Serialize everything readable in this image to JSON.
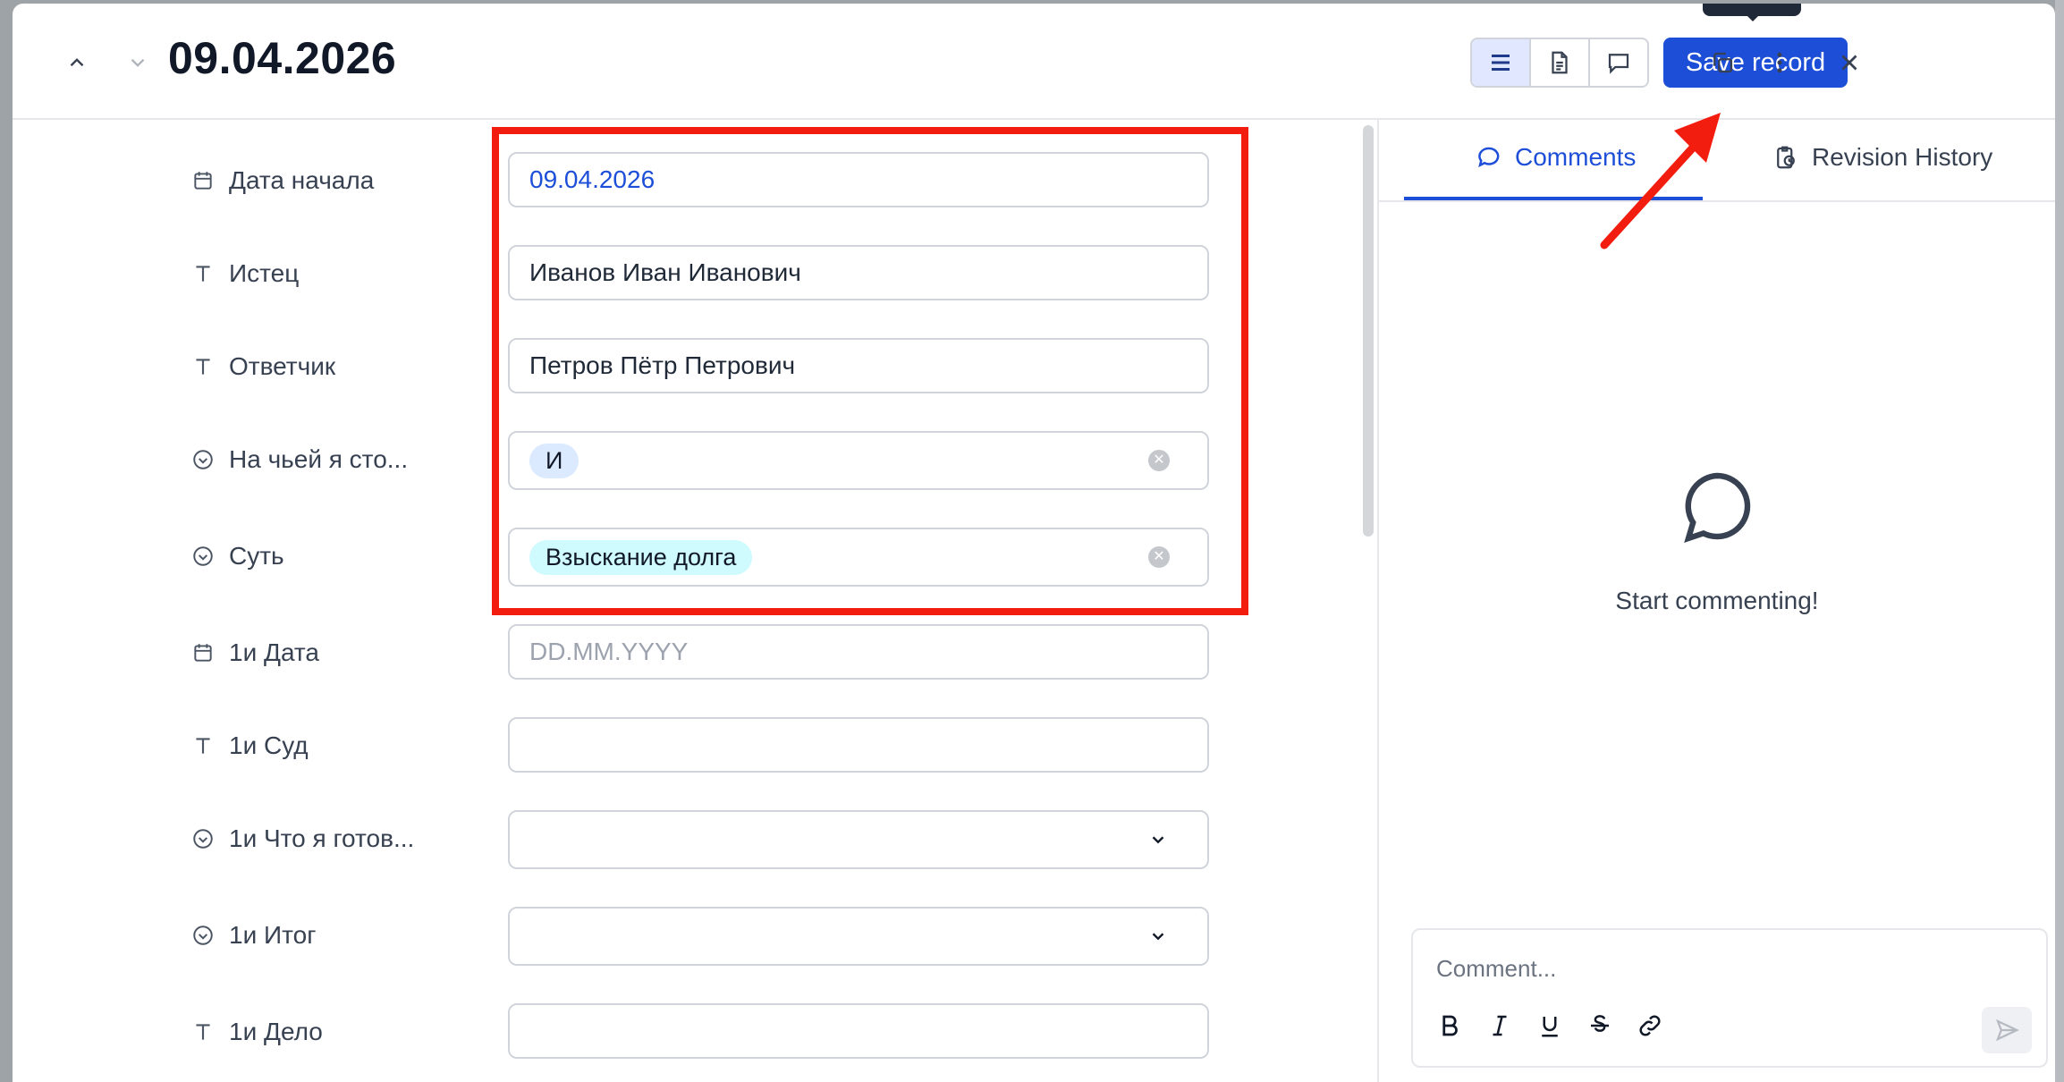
{
  "header": {
    "title": "09.04.2026",
    "save_label": "Save record"
  },
  "fields": [
    {
      "label": "Дата начала",
      "icon": "calendar-icon",
      "value": "09.04.2026",
      "kind": "date"
    },
    {
      "label": "Истец",
      "icon": "text-icon",
      "value": "Иванов Иван Иванович",
      "kind": "text"
    },
    {
      "label": "Ответчик",
      "icon": "text-icon",
      "value": "Петров Пётр Петрович",
      "kind": "text"
    },
    {
      "label": "На чьей я сто...",
      "icon": "select-icon",
      "value": "И",
      "kind": "select"
    },
    {
      "label": "Суть",
      "icon": "select-icon",
      "value": "Взыскание долга",
      "kind": "select"
    },
    {
      "label": "1и Дата",
      "icon": "calendar-icon",
      "placeholder": "DD.MM.YYYY",
      "kind": "date"
    },
    {
      "label": "1и Суд",
      "icon": "text-icon",
      "value": "",
      "kind": "text"
    },
    {
      "label": "1и Что я готов...",
      "icon": "select-icon",
      "value": "",
      "kind": "dropdown"
    },
    {
      "label": "1и Итог",
      "icon": "select-icon",
      "value": "",
      "kind": "dropdown"
    },
    {
      "label": "1и Дело",
      "icon": "text-icon",
      "value": "",
      "kind": "text"
    }
  ],
  "sidebar": {
    "tabs": [
      {
        "label": "Comments",
        "icon": "chat-icon",
        "active": true
      },
      {
        "label": "Revision History",
        "icon": "history-icon",
        "active": false
      }
    ],
    "empty_text": "Start commenting!",
    "comment_placeholder": "Comment..."
  },
  "colors": {
    "accent": "#1d4ed8",
    "highlight": "#f21d0f",
    "tag_blue": "#dbeafe",
    "tag_cyan": "#cffafe"
  }
}
